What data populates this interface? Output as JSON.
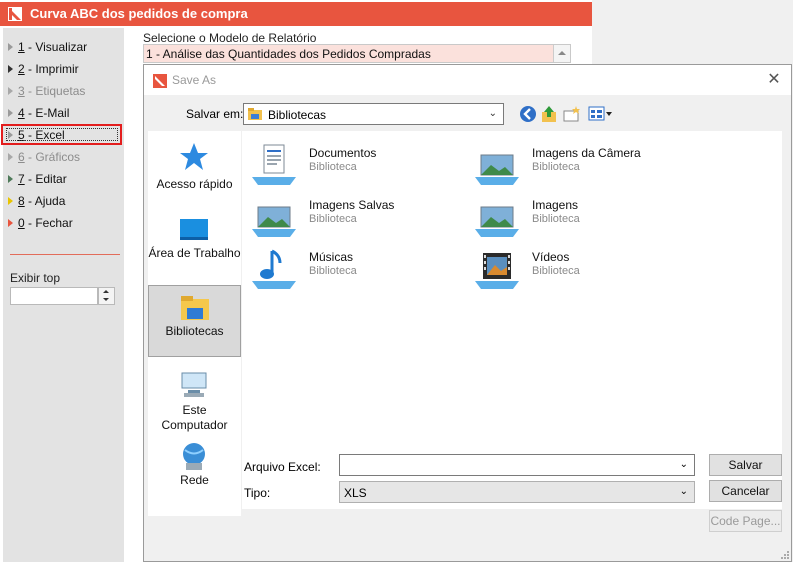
{
  "app": {
    "title": "Curva ABC dos pedidos de compra",
    "brand_color": "#e8553f",
    "menu": [
      {
        "key": "1",
        "text": " - Visualizar",
        "disabled": false,
        "arrow": "#8a8a8a"
      },
      {
        "key": "2",
        "text": " - Imprimir",
        "disabled": false,
        "arrow": "#333333"
      },
      {
        "key": "3",
        "text": " - Etiquetas",
        "disabled": true,
        "arrow": "#9a9a9a"
      },
      {
        "key": "4",
        "text": " - E-Mail",
        "disabled": false,
        "arrow": "#8a8a8a"
      },
      {
        "key": "5",
        "text": " - Excel",
        "disabled": false,
        "arrow": "#8a8a8a"
      },
      {
        "key": "6",
        "text": " - Gráficos",
        "disabled": true,
        "arrow": "#9a9a9a"
      },
      {
        "key": "7",
        "text": " - Editar",
        "disabled": false,
        "arrow": "#5a7a5a"
      },
      {
        "key": "8",
        "text": " - Ajuda",
        "disabled": false,
        "arrow": "#e8c400"
      },
      {
        "key": "0",
        "text": " - Fechar",
        "disabled": false,
        "arrow": "#e8553f"
      }
    ],
    "exibir_label": "Exibir top",
    "exibir_value": "",
    "model_label": "Selecione o Modelo de Relatório",
    "model_value": "1 - Análise das Quantidades dos Pedidos Compradas"
  },
  "dialog": {
    "title": "Save As",
    "save_in_label": "Salvar em:",
    "save_in_value": "Bibliotecas",
    "places": [
      {
        "label": "Acesso rápido",
        "icon": "star-icon",
        "selected": false
      },
      {
        "label": "Área de Trabalho",
        "icon": "desktop-icon",
        "selected": false
      },
      {
        "label": "Bibliotecas",
        "icon": "libraries-folder-icon",
        "selected": true
      },
      {
        "label": "Este Computador",
        "icon": "computer-icon",
        "selected": false
      },
      {
        "label": "Rede",
        "icon": "network-icon",
        "selected": false
      }
    ],
    "items": [
      {
        "name": "Documentos",
        "sub": "Biblioteca",
        "icon": "documents-library-icon"
      },
      {
        "name": "Imagens da Câmera",
        "sub": "Biblioteca",
        "icon": "camera-roll-library-icon"
      },
      {
        "name": "Imagens Salvas",
        "sub": "Biblioteca",
        "icon": "saved-pictures-library-icon"
      },
      {
        "name": "Imagens",
        "sub": "Biblioteca",
        "icon": "pictures-library-icon"
      },
      {
        "name": "Músicas",
        "sub": "Biblioteca",
        "icon": "music-library-icon"
      },
      {
        "name": "Vídeos",
        "sub": "Biblioteca",
        "icon": "videos-library-icon"
      }
    ],
    "filename_label": "Arquivo Excel:",
    "filename_value": "",
    "type_label": "Tipo:",
    "type_value": "XLS",
    "save_button": "Salvar",
    "cancel_button": "Cancelar",
    "code_page_button": "Code Page..."
  }
}
